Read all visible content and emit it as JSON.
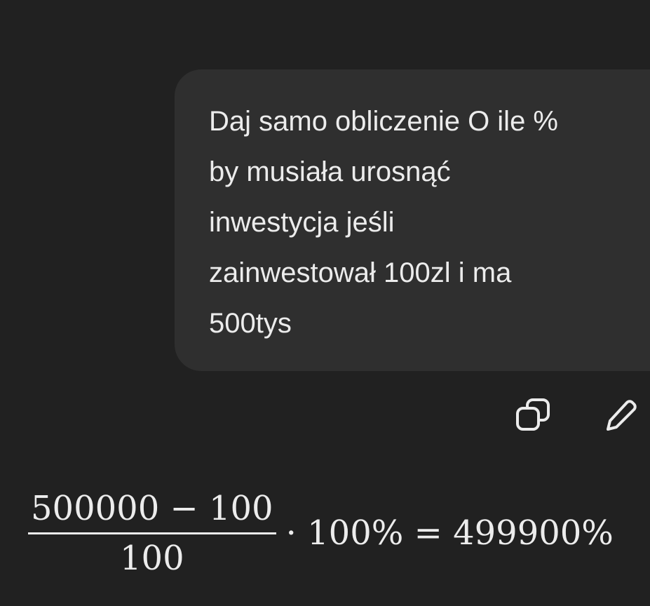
{
  "user_message": {
    "text": "Daj samo obliczenie O ile %\nby musiała urosnąć\ninwestycja jeśli\nzainwestował 100zl i ma\n500tys"
  },
  "actions": {
    "copy_icon": "copy-icon",
    "edit_icon": "pencil-icon"
  },
  "assistant_math": {
    "numerator": "500000 − 100",
    "denominator": "100",
    "rest": "· 100% = 499900%"
  },
  "colors": {
    "background": "#212121",
    "bubble": "#2f2f2f",
    "text": "#ececec"
  }
}
